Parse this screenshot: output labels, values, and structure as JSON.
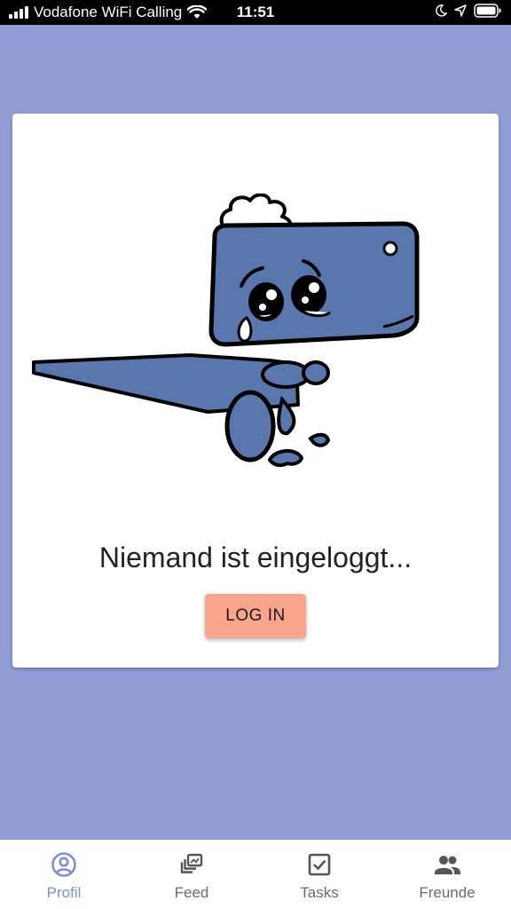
{
  "status_bar": {
    "carrier": "Vodafone WiFi Calling",
    "time": "11:51"
  },
  "card": {
    "message": "Niemand ist eingeloggt...",
    "login_label": "LOG IN"
  },
  "bottom_nav": {
    "items": [
      {
        "label": "Profil",
        "icon": "profile-icon",
        "active": true
      },
      {
        "label": "Feed",
        "icon": "feed-icon",
        "active": false
      },
      {
        "label": "Tasks",
        "icon": "tasks-checkbox-icon",
        "active": false
      },
      {
        "label": "Freunde",
        "icon": "friends-icon",
        "active": false
      }
    ]
  },
  "colors": {
    "background": "#919bd4",
    "accent": "#7f8fd0",
    "button": "#f9a58c",
    "dino": "#5a77ad"
  }
}
